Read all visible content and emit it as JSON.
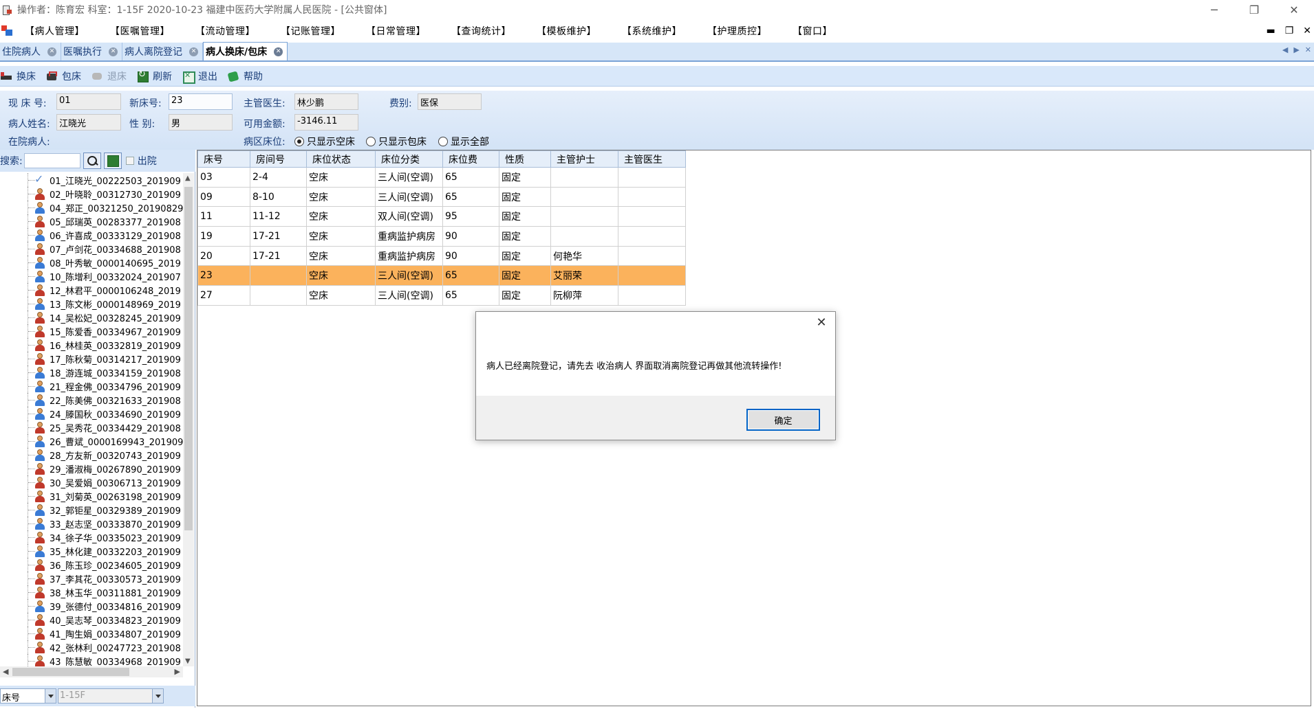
{
  "window": {
    "title": "操作者：陈育宏  科室：1-15F  2020-10-23  福建中医药大学附属人民医院 - [公共窗体]",
    "controls": [
      "─",
      "❐",
      "✕"
    ]
  },
  "menu": {
    "items": [
      "【病人管理】",
      "【医嘱管理】",
      "【流动管理】",
      "【记账管理】",
      "【日常管理】",
      "【查询统计】",
      "【模板维护】",
      "【系统维护】",
      "【护理质控】",
      "【窗口】"
    ],
    "mdi_controls": [
      "▬",
      "❐",
      "✕"
    ]
  },
  "tabs": [
    {
      "label": "住院病人",
      "active": false
    },
    {
      "label": "医嘱执行",
      "active": false
    },
    {
      "label": "病人离院登记",
      "active": false
    },
    {
      "label": "病人换床/包床",
      "active": true
    }
  ],
  "tab_nav": [
    "◀",
    "▶",
    "✕"
  ],
  "toolbar": {
    "buttons": [
      {
        "label": "换床",
        "icon": "bed-icon",
        "enabled": true
      },
      {
        "label": "包床",
        "icon": "bag-icon",
        "enabled": true
      },
      {
        "label": "退床",
        "icon": "hand-icon",
        "enabled": false
      },
      {
        "label": "刷新",
        "icon": "refresh-icon",
        "enabled": true
      },
      {
        "label": "退出",
        "icon": "exit-icon",
        "enabled": true
      },
      {
        "label": "帮助",
        "icon": "help-icon",
        "enabled": true
      }
    ]
  },
  "form": {
    "current_bed_label": "现 床 号:",
    "current_bed_value": "01",
    "new_bed_label": "新床号:",
    "new_bed_value": "23",
    "doctor_label": "主管医生:",
    "doctor_value": "林少鹏",
    "fee_type_label": "费别:",
    "fee_type_value": "医保",
    "patient_name_label": "病人姓名:",
    "patient_name_value": "江晓光",
    "gender_label": "性   别:",
    "gender_value": "男",
    "balance_label": "可用金额:",
    "balance_value": "-3146.11",
    "inpatient_label": "在院病人:",
    "ward_bed_label": "病区床位:",
    "radio_options": [
      "只显示空床",
      "只显示包床",
      "显示全部"
    ],
    "radio_selected": 0
  },
  "search": {
    "label": "搜索:",
    "value": "",
    "discharged_label": "出院",
    "discharged_checked": false
  },
  "patients": [
    {
      "label": "01_江晓光_00222503_201909",
      "icon": "check"
    },
    {
      "label": "02_叶晓聆_00312730_201909",
      "icon": "f"
    },
    {
      "label": "04_郑正_00321250_20190829",
      "icon": "m"
    },
    {
      "label": "05_邱瑞英_00283377_201908",
      "icon": "f"
    },
    {
      "label": "06_许喜成_00333129_201908",
      "icon": "m"
    },
    {
      "label": "07_卢剑花_00334688_201908",
      "icon": "f"
    },
    {
      "label": "08_叶秀敏_0000140695_2019",
      "icon": "m"
    },
    {
      "label": "10_陈增利_00332024_201907",
      "icon": "m"
    },
    {
      "label": "12_林君平_0000106248_2019",
      "icon": "f"
    },
    {
      "label": "13_陈文彬_0000148969_2019",
      "icon": "m"
    },
    {
      "label": "14_吴松妃_00328245_201909",
      "icon": "f"
    },
    {
      "label": "15_陈爱香_00334967_201909",
      "icon": "f"
    },
    {
      "label": "16_林桂英_00332819_201909",
      "icon": "f"
    },
    {
      "label": "17_陈秋菊_00314217_201909",
      "icon": "f"
    },
    {
      "label": "18_游连城_00334159_201908",
      "icon": "m"
    },
    {
      "label": "21_程金佛_00334796_201909",
      "icon": "m"
    },
    {
      "label": "22_陈美佛_00321633_201908",
      "icon": "m"
    },
    {
      "label": "24_滕国秋_00334690_201909",
      "icon": "m"
    },
    {
      "label": "25_吴秀花_00334429_201908",
      "icon": "f"
    },
    {
      "label": "26_曹斌_0000169943_201909",
      "icon": "m"
    },
    {
      "label": "28_方友新_00320743_201909",
      "icon": "m"
    },
    {
      "label": "29_潘淑梅_00267890_201909",
      "icon": "f"
    },
    {
      "label": "30_吴爱娟_00306713_201909",
      "icon": "f"
    },
    {
      "label": "31_刘菊英_00263198_201909",
      "icon": "f"
    },
    {
      "label": "32_郭钜星_00329389_201909",
      "icon": "m"
    },
    {
      "label": "33_赵志坚_00333870_201909",
      "icon": "m"
    },
    {
      "label": "34_徐子华_00335023_201909",
      "icon": "f"
    },
    {
      "label": "35_林化建_00332203_201909",
      "icon": "m"
    },
    {
      "label": "36_陈玉珍_00234605_201909",
      "icon": "f"
    },
    {
      "label": "37_李其花_00330573_201909",
      "icon": "f"
    },
    {
      "label": "38_林玉华_00311881_201909",
      "icon": "f"
    },
    {
      "label": "39_张德付_00334816_201909",
      "icon": "m"
    },
    {
      "label": "40_吴志琴_00334823_201909",
      "icon": "f"
    },
    {
      "label": "41_陶生娟_00334807_201909",
      "icon": "f"
    },
    {
      "label": "42_张林利_00247723_201908",
      "icon": "f"
    },
    {
      "label": "43_陈慧敏_00334968_201909",
      "icon": "f"
    }
  ],
  "bottom": {
    "sort_value": "床号",
    "ward_value": "1-15F"
  },
  "grid": {
    "columns": [
      "床号",
      "房间号",
      "床位状态",
      "床位分类",
      "床位费",
      "性质",
      "主管护士",
      "主管医生"
    ],
    "rows": [
      [
        "03",
        "2-4",
        "空床",
        "三人间(空调)",
        "65",
        "固定",
        "",
        ""
      ],
      [
        "09",
        "8-10",
        "空床",
        "三人间(空调)",
        "65",
        "固定",
        "",
        ""
      ],
      [
        "11",
        "11-12",
        "空床",
        "双人间(空调)",
        "95",
        "固定",
        "",
        ""
      ],
      [
        "19",
        "17-21",
        "空床",
        "重病监护病房",
        "90",
        "固定",
        "",
        ""
      ],
      [
        "20",
        "17-21",
        "空床",
        "重病监护病房",
        "90",
        "固定",
        "何艳华",
        ""
      ],
      [
        "23",
        "",
        "空床",
        "三人间(空调)",
        "65",
        "固定",
        "艾丽荣",
        ""
      ],
      [
        "27",
        "",
        "空床",
        "三人间(空调)",
        "65",
        "固定",
        "阮柳萍",
        ""
      ]
    ],
    "selected_row": 5
  },
  "dialog": {
    "message": "病人已经离院登记，请先去 收治病人 界面取消离院登记再做其他流转操作!",
    "ok_label": "确定",
    "close_glyph": "✕"
  }
}
